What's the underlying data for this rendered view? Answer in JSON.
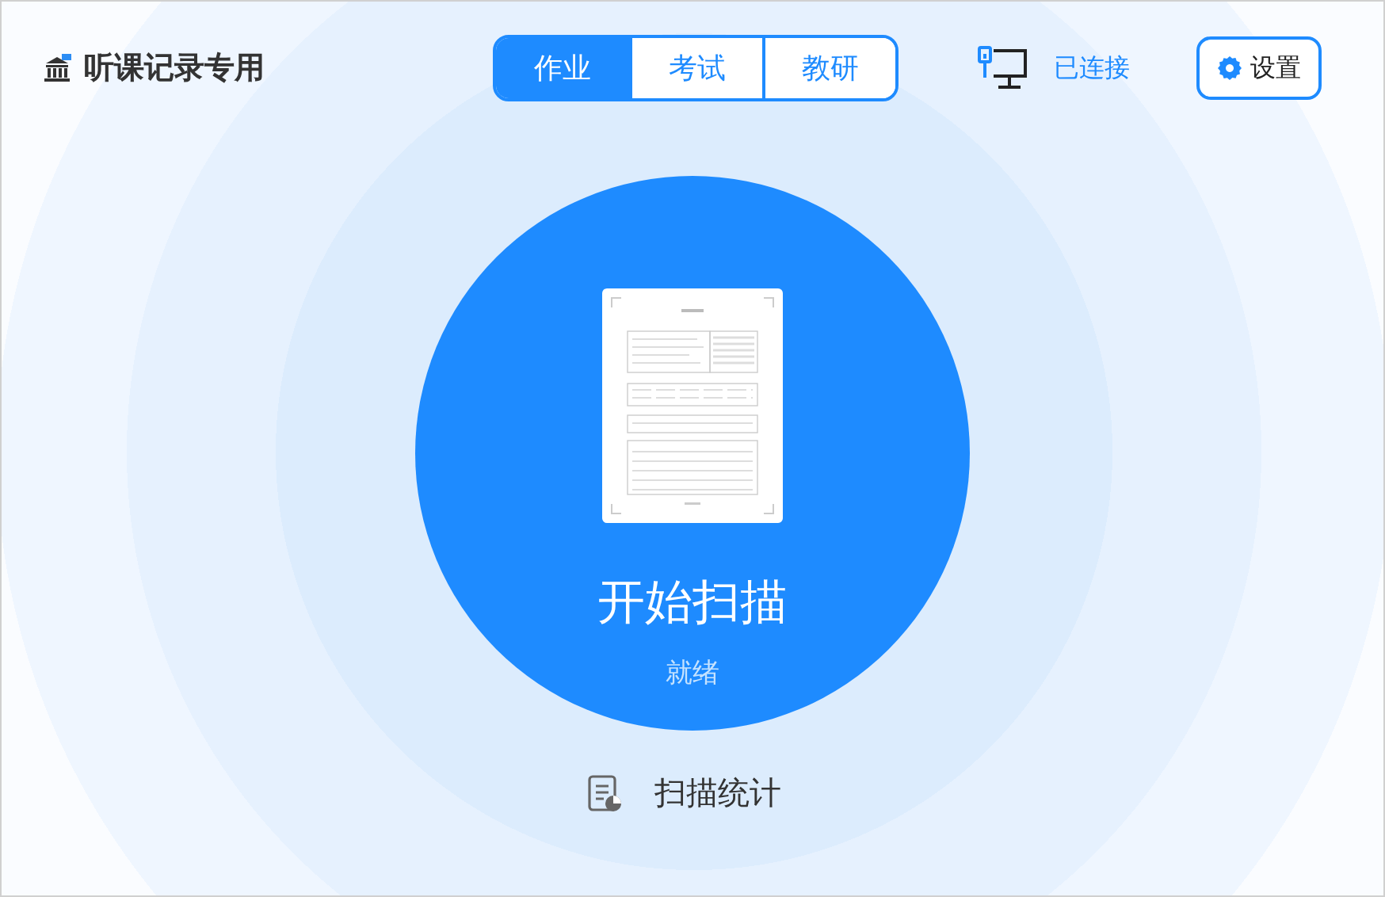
{
  "app_title": "听课记录专用",
  "tabs": [
    {
      "label": "作业",
      "selected": true
    },
    {
      "label": "考试",
      "selected": false
    },
    {
      "label": "教研",
      "selected": false
    }
  ],
  "connection": {
    "status": "已连接"
  },
  "settings_button": "设置",
  "scan_button": {
    "label": "开始扫描",
    "status": "就绪"
  },
  "stats_link": "扫描统计"
}
